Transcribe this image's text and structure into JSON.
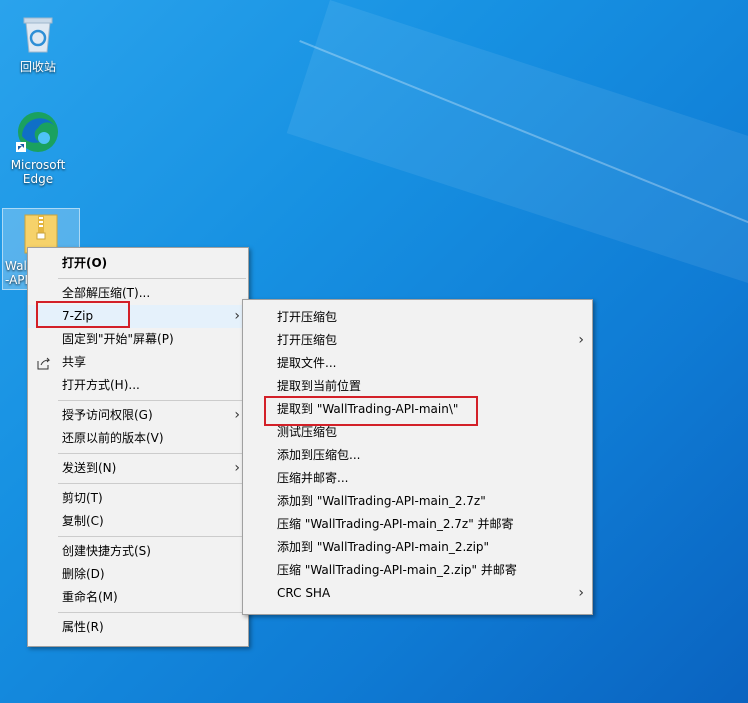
{
  "desktop": {
    "icons": [
      {
        "label": "回收站",
        "icon": "recycle-bin-icon"
      },
      {
        "label": "Microsoft Edge",
        "icon": "edge-icon"
      },
      {
        "label": "Wal\n-API",
        "icon": "zip-folder-icon"
      }
    ]
  },
  "context_menu": {
    "items": [
      {
        "label": "打开(O)"
      },
      {
        "label": "全部解压缩(T)..."
      },
      {
        "label": "7-Zip"
      },
      {
        "label": "固定到\"开始\"屏幕(P)"
      },
      {
        "label": "共享",
        "icon": "share-icon"
      },
      {
        "label": "打开方式(H)..."
      },
      {
        "label": "授予访问权限(G)"
      },
      {
        "label": "还原以前的版本(V)"
      },
      {
        "label": "发送到(N)"
      },
      {
        "label": "剪切(T)"
      },
      {
        "label": "复制(C)"
      },
      {
        "label": "创建快捷方式(S)"
      },
      {
        "label": "删除(D)"
      },
      {
        "label": "重命名(M)"
      },
      {
        "label": "属性(R)"
      }
    ]
  },
  "submenu_7zip": {
    "items": [
      {
        "label": "打开压缩包"
      },
      {
        "label": "打开压缩包"
      },
      {
        "label": "提取文件..."
      },
      {
        "label": "提取到当前位置"
      },
      {
        "label": "提取到 \"WallTrading-API-main\\\""
      },
      {
        "label": "测试压缩包"
      },
      {
        "label": "添加到压缩包..."
      },
      {
        "label": "压缩并邮寄..."
      },
      {
        "label": "添加到 \"WallTrading-API-main_2.7z\""
      },
      {
        "label": "压缩 \"WallTrading-API-main_2.7z\" 并邮寄"
      },
      {
        "label": "添加到 \"WallTrading-API-main_2.zip\""
      },
      {
        "label": "压缩 \"WallTrading-API-main_2.zip\" 并邮寄"
      },
      {
        "label": "CRC SHA"
      }
    ]
  },
  "colors": {
    "highlight": "#d32028",
    "desktop": "#1791e2"
  }
}
